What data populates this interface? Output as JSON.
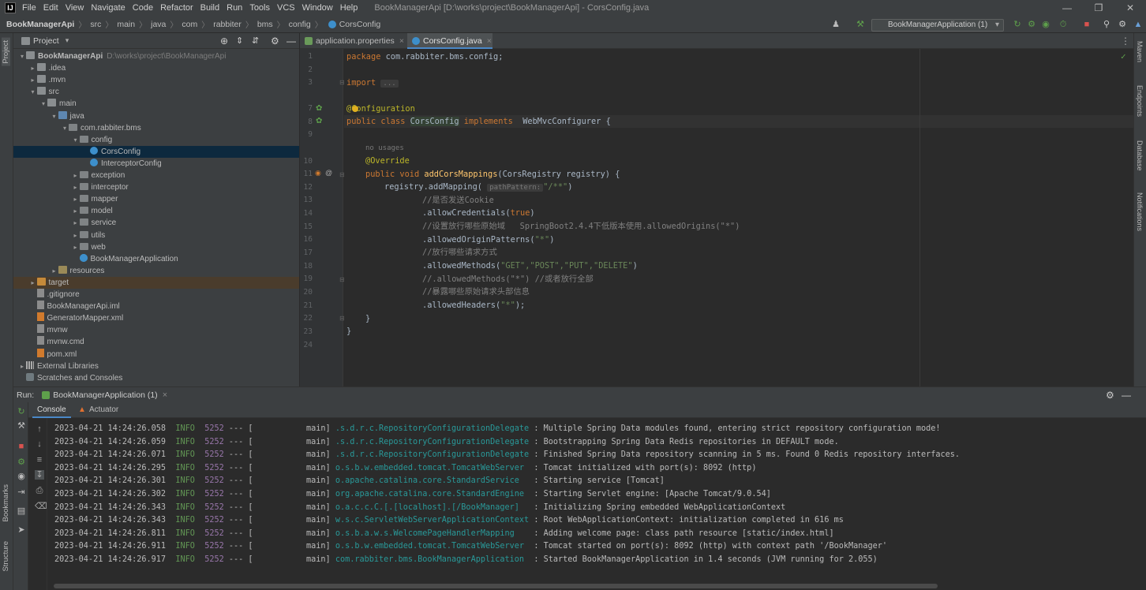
{
  "menubar": {
    "items": [
      "File",
      "Edit",
      "View",
      "Navigate",
      "Code",
      "Refactor",
      "Build",
      "Run",
      "Tools",
      "VCS",
      "Window",
      "Help"
    ],
    "window_title": "BookManagerApi [D:\\works\\project\\BookManagerApi] - CorsConfig.java"
  },
  "breadcrumb": [
    "BookManagerApi",
    "src",
    "main",
    "java",
    "com",
    "rabbiter",
    "bms",
    "config",
    "CorsConfig"
  ],
  "run_config": "BookManagerApplication (1)",
  "left_stripe": {
    "project_tab": "Project",
    "bookmarks_tab": "Bookmarks",
    "structure_tab": "Structure"
  },
  "right_stripe": {
    "maven": "Maven",
    "endpoints": "Endpoints",
    "database": "Database",
    "notifications": "Notifications"
  },
  "project_panel": {
    "title": "Project",
    "tree": [
      {
        "label": "BookManagerApi",
        "path": "D:\\works\\project\\BookManagerApi",
        "depth": 0,
        "icon": "folder",
        "expanded": true
      },
      {
        "label": ".idea",
        "depth": 1,
        "icon": "folder",
        "expanded": false
      },
      {
        "label": ".mvn",
        "depth": 1,
        "icon": "folder",
        "expanded": false
      },
      {
        "label": "src",
        "depth": 1,
        "icon": "folder",
        "expanded": true
      },
      {
        "label": "main",
        "depth": 2,
        "icon": "folder",
        "expanded": true
      },
      {
        "label": "java",
        "depth": 3,
        "icon": "folder-src",
        "expanded": true
      },
      {
        "label": "com.rabbiter.bms",
        "depth": 4,
        "icon": "package",
        "expanded": true
      },
      {
        "label": "config",
        "depth": 5,
        "icon": "package",
        "expanded": true
      },
      {
        "label": "CorsConfig",
        "depth": 6,
        "icon": "class",
        "selected": true
      },
      {
        "label": "InterceptorConfig",
        "depth": 6,
        "icon": "class"
      },
      {
        "label": "exception",
        "depth": 5,
        "icon": "package",
        "expanded": false
      },
      {
        "label": "interceptor",
        "depth": 5,
        "icon": "package",
        "expanded": false
      },
      {
        "label": "mapper",
        "depth": 5,
        "icon": "package",
        "expanded": false
      },
      {
        "label": "model",
        "depth": 5,
        "icon": "package",
        "expanded": false
      },
      {
        "label": "service",
        "depth": 5,
        "icon": "package",
        "expanded": false
      },
      {
        "label": "utils",
        "depth": 5,
        "icon": "package",
        "expanded": false
      },
      {
        "label": "web",
        "depth": 5,
        "icon": "package",
        "expanded": false
      },
      {
        "label": "BookManagerApplication",
        "depth": 5,
        "icon": "class-spring"
      },
      {
        "label": "resources",
        "depth": 3,
        "icon": "folder-res",
        "expanded": false
      },
      {
        "label": "target",
        "depth": 1,
        "icon": "folder-target",
        "expanded": false,
        "highlight": true
      },
      {
        "label": ".gitignore",
        "depth": 1,
        "icon": "file"
      },
      {
        "label": "BookManagerApi.iml",
        "depth": 1,
        "icon": "file"
      },
      {
        "label": "GeneratorMapper.xml",
        "depth": 1,
        "icon": "xml"
      },
      {
        "label": "mvnw",
        "depth": 1,
        "icon": "file"
      },
      {
        "label": "mvnw.cmd",
        "depth": 1,
        "icon": "file"
      },
      {
        "label": "pom.xml",
        "depth": 1,
        "icon": "xml"
      },
      {
        "label": "External Libraries",
        "depth": 0,
        "icon": "library",
        "expanded": false
      },
      {
        "label": "Scratches and Consoles",
        "depth": 0,
        "icon": "scratch"
      }
    ]
  },
  "editor": {
    "tabs": [
      {
        "label": "application.properties",
        "active": false
      },
      {
        "label": "CorsConfig.java",
        "active": true
      }
    ],
    "line_numbers": [
      "1",
      "2",
      "3",
      "7",
      "8",
      "9",
      "10",
      "11",
      "12",
      "13",
      "14",
      "15",
      "16",
      "17",
      "18",
      "19",
      "20",
      "21",
      "22",
      "23",
      "24"
    ],
    "code": {
      "l1_kw": "package ",
      "l1_rest": "com.rabbiter.bms.config;",
      "l3_kw": "import ",
      "l3_rest": "...",
      "l7": "@Configuration",
      "l8_kw1": "public class ",
      "l8_cls": "CorsConfig",
      "l8_kw2": " implements ",
      "l8_rest": "WebMvcConfigurer {",
      "usages": "no usages",
      "l10": "@Override",
      "l11_kw": "public void ",
      "l11_fn": "addCorsMappings",
      "l11_rest": "(CorsRegistry registry) {",
      "l12_a": "registry.addMapping(",
      "l12_hint": "pathPattern:",
      "l12_str": "\"/**\"",
      "l12_b": ")",
      "l13": "//是否发送Cookie",
      "l14_a": ".allowCredentials(",
      "l14_kw": "true",
      "l14_b": ")",
      "l15": "//设置放行哪些原始域   SpringBoot2.4.4下低版本使用.allowedOrigins(\"*\")",
      "l16_a": ".allowedOriginPatterns(",
      "l16_str": "\"*\"",
      "l16_b": ")",
      "l17": "//放行哪些请求方式",
      "l18_a": ".allowedMethods(",
      "l18_str": "\"GET\",\"POST\",\"PUT\",\"DELETE\"",
      "l18_b": ")",
      "l19": "//.allowedMethods(\"*\") //或者放行全部",
      "l20": "//暴露哪些原始请求头部信息",
      "l21_a": ".allowedHeaders(",
      "l21_str": "\"*\"",
      "l21_b": ");",
      "l22": "}",
      "l23": "}"
    }
  },
  "run_panel": {
    "label": "Run:",
    "config_tab": "BookManagerApplication (1)",
    "tabs": [
      "Console",
      "Actuator"
    ],
    "logs": [
      {
        "ts": "2023-04-21 14:24:26.058",
        "level": "INFO",
        "pid": "5252",
        "sep": "--- [",
        "thread": "main]",
        "logger": ".s.d.r.c.RepositoryConfigurationDelegate",
        "msg": ": Multiple Spring Data modules found, entering strict repository configuration mode!"
      },
      {
        "ts": "2023-04-21 14:24:26.059",
        "level": "INFO",
        "pid": "5252",
        "sep": "--- [",
        "thread": "main]",
        "logger": ".s.d.r.c.RepositoryConfigurationDelegate",
        "msg": ": Bootstrapping Spring Data Redis repositories in DEFAULT mode."
      },
      {
        "ts": "2023-04-21 14:24:26.071",
        "level": "INFO",
        "pid": "5252",
        "sep": "--- [",
        "thread": "main]",
        "logger": ".s.d.r.c.RepositoryConfigurationDelegate",
        "msg": ": Finished Spring Data repository scanning in 5 ms. Found 0 Redis repository interfaces."
      },
      {
        "ts": "2023-04-21 14:24:26.295",
        "level": "INFO",
        "pid": "5252",
        "sep": "--- [",
        "thread": "main]",
        "logger": "o.s.b.w.embedded.tomcat.TomcatWebServer",
        "msg": ": Tomcat initialized with port(s): 8092 (http)"
      },
      {
        "ts": "2023-04-21 14:24:26.301",
        "level": "INFO",
        "pid": "5252",
        "sep": "--- [",
        "thread": "main]",
        "logger": "o.apache.catalina.core.StandardService",
        "msg": ": Starting service [Tomcat]"
      },
      {
        "ts": "2023-04-21 14:24:26.302",
        "level": "INFO",
        "pid": "5252",
        "sep": "--- [",
        "thread": "main]",
        "logger": "org.apache.catalina.core.StandardEngine",
        "msg": ": Starting Servlet engine: [Apache Tomcat/9.0.54]"
      },
      {
        "ts": "2023-04-21 14:24:26.343",
        "level": "INFO",
        "pid": "5252",
        "sep": "--- [",
        "thread": "main]",
        "logger": "o.a.c.c.C.[.[localhost].[/BookManager]",
        "msg": ": Initializing Spring embedded WebApplicationContext"
      },
      {
        "ts": "2023-04-21 14:24:26.343",
        "level": "INFO",
        "pid": "5252",
        "sep": "--- [",
        "thread": "main]",
        "logger": "w.s.c.ServletWebServerApplicationContext",
        "msg": ": Root WebApplicationContext: initialization completed in 616 ms"
      },
      {
        "ts": "2023-04-21 14:24:26.811",
        "level": "INFO",
        "pid": "5252",
        "sep": "--- [",
        "thread": "main]",
        "logger": "o.s.b.a.w.s.WelcomePageHandlerMapping",
        "msg": ": Adding welcome page: class path resource [static/index.html]"
      },
      {
        "ts": "2023-04-21 14:24:26.911",
        "level": "INFO",
        "pid": "5252",
        "sep": "--- [",
        "thread": "main]",
        "logger": "o.s.b.w.embedded.tomcat.TomcatWebServer",
        "msg": ": Tomcat started on port(s): 8092 (http) with context path '/BookManager'"
      },
      {
        "ts": "2023-04-21 14:24:26.917",
        "level": "INFO",
        "pid": "5252",
        "sep": "--- [",
        "thread": "main]",
        "logger": "com.rabbiter.bms.BookManagerApplication",
        "msg": ": Started BookManagerApplication in 1.4 seconds (JVM running for 2.055)"
      }
    ]
  },
  "colors": {
    "accent": "#4a88c7",
    "selection": "#0d293e",
    "keyword": "#cc7832",
    "annotation": "#bbb529",
    "string": "#6a8759",
    "comment": "#808080",
    "log_info": "#629755",
    "log_logger": "#299999"
  }
}
